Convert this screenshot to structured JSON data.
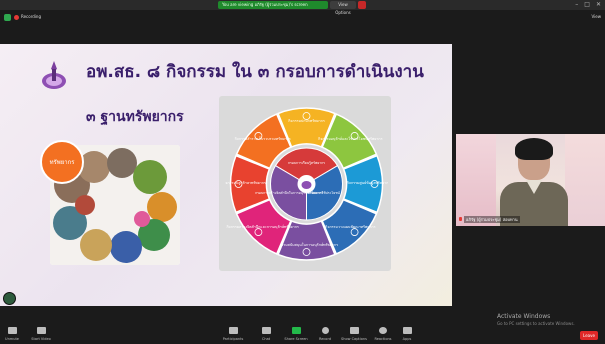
{
  "window": {
    "sharing_text": "You are viewing อภิรัฐ (ผู้ร่วมประชุม)'s screen",
    "view_options": "View Options"
  },
  "meeting_bar": {
    "recording_label": "Recording",
    "view_label": "View"
  },
  "slide": {
    "title": "อพ.สธ. ๘ กิจกรรม ใน ๓ กรอบการดำเนินงาน",
    "subtitle": "๓ ฐานทรัพยากร",
    "photo_circle_label": "ทรัพยากร",
    "wheel_center_top": "กรอบการเรียนรู้ทรัพยากร",
    "wheel_center_right": "กรอบการใช้ประโยชน์",
    "wheel_center_bottom": "กรอบการสร้างจิตสำนึกในการอนุรักษ์ทรัพยากร",
    "wheel_segments": [
      {
        "label": "กิจกรรมปกปักทรัพยากร",
        "color": "#f5b323"
      },
      {
        "label": "กิจกรรมอนุรักษ์และใช้ประโยชน์ทรัพยากร",
        "color": "#8dc63f"
      },
      {
        "label": "กิจกรรมศูนย์ข้อมูลทรัพยากร",
        "color": "#1c9ad6"
      },
      {
        "label": "กิจกรรมวางแผนพัฒนาทรัพยากร",
        "color": "#2c6db6"
      },
      {
        "label": "กิจกรรมสนับสนุนในการอนุรักษ์ทรัพยากร",
        "color": "#7a4fa0"
      },
      {
        "label": "กิจกรรมสร้างจิตสำนึกและการอนุรักษ์ทรัพยากร",
        "color": "#e0247a"
      },
      {
        "label": "กิจกรรมปลูกรักษาทรัพยากร",
        "color": "#e8422f"
      },
      {
        "label": "กิจกรรมสำรวจเก็บรวบรวมทรัพยากร",
        "color": "#f37021"
      }
    ]
  },
  "video": {
    "participant_name": "อภิรัฐ (ผู้ร่วมประชุม) สอบทาน"
  },
  "watermark": {
    "title": "Activate Windows",
    "subtitle": "Go to PC settings to activate Windows."
  },
  "toolbar": {
    "items": [
      {
        "label": "Unmute"
      },
      {
        "label": "Start Video"
      },
      {
        "label": "Participants"
      },
      {
        "label": "Chat"
      },
      {
        "label": "Share Screen"
      },
      {
        "label": "Record"
      },
      {
        "label": "Show Captions"
      },
      {
        "label": "Reactions"
      },
      {
        "label": "Apps"
      }
    ],
    "participant_count": "2",
    "end_label": "Leave"
  }
}
